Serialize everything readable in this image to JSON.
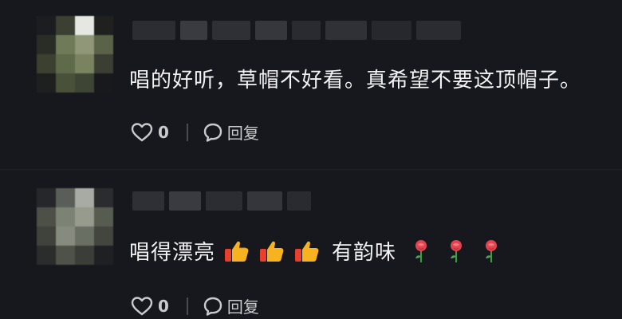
{
  "comments": [
    {
      "text": "唱的好听，草帽不好看。真希望不要这顶帽子。",
      "likes": "0",
      "reply_label": "回复"
    },
    {
      "text_before": "唱得漂亮",
      "text_middle": "有韵味",
      "emojis": [
        "thumbs-up",
        "thumbs-up",
        "thumbs-up",
        "rose",
        "rose",
        "rose"
      ],
      "likes": "0",
      "reply_label": "回复"
    }
  ],
  "colors": {
    "background": "#17181d",
    "text": "#f2f2f4",
    "muted": "#c9cacd"
  }
}
